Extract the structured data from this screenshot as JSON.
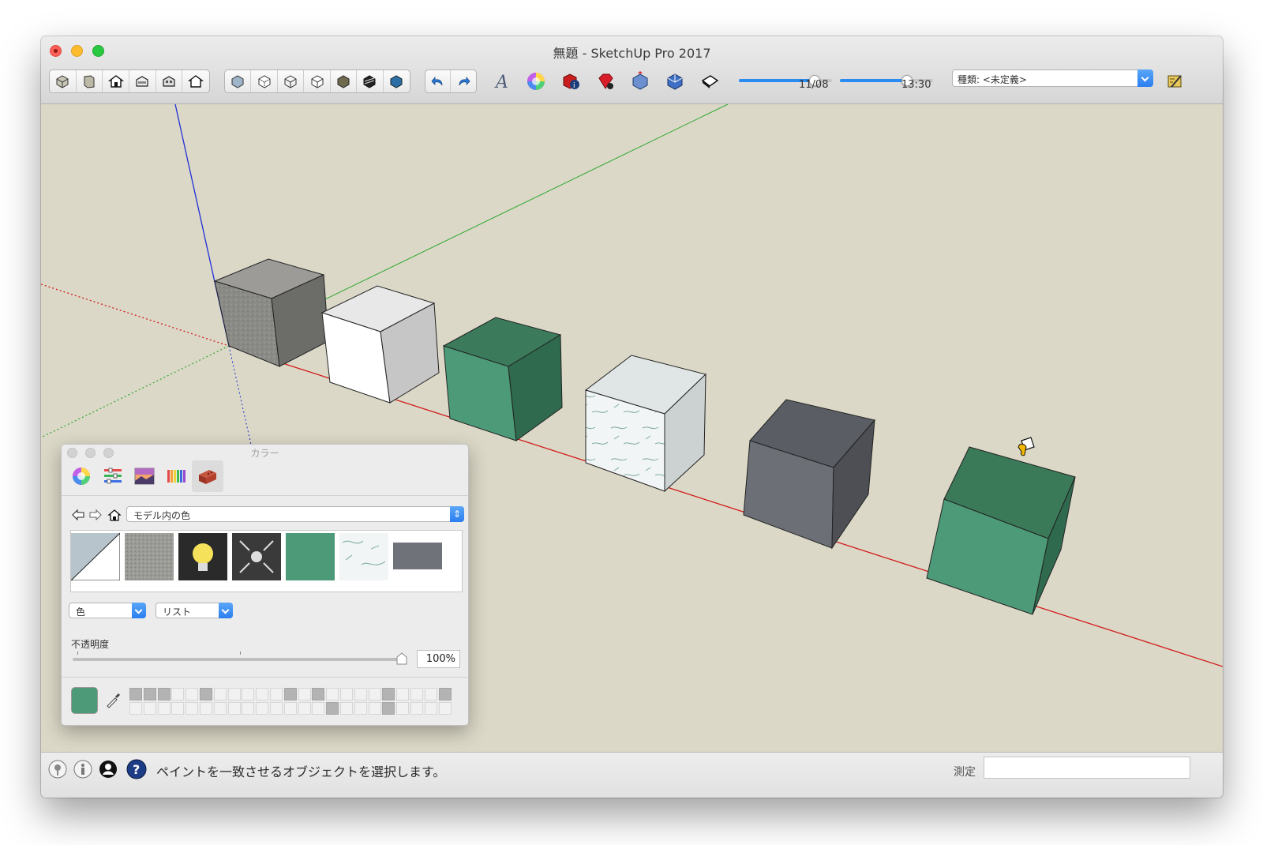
{
  "window": {
    "title": "無題 - SketchUp Pro 2017"
  },
  "toolbar": {
    "shadow_date": "11/08",
    "shadow_time": "13:30",
    "style_select_value": "種類: <未定義>",
    "colors": {
      "accent": "#2a8cf3"
    }
  },
  "color_panel": {
    "title": "カラー",
    "collection_select": "モデル内の色",
    "type_select": "色",
    "view_select": "リスト",
    "opacity_label": "不透明度",
    "opacity_value": "100%",
    "current_color": "#4c9a78"
  },
  "status": {
    "message": "ペイントを一致させるオブジェクトを選択します。",
    "measure_label": "測定",
    "measure_value": ""
  },
  "icons": {
    "toolbar_views": [
      "iso-view-icon",
      "top-view-icon",
      "front-view-icon",
      "right-view-icon",
      "back-view-icon",
      "left-view-icon"
    ],
    "toolbar_styles": [
      "xray-icon",
      "back-edges-icon",
      "wireframe-icon",
      "hidden-line-icon",
      "shaded-icon",
      "shaded-textures-icon",
      "monochrome-icon"
    ],
    "colors": {
      "green_material": "#4c9a78",
      "axis_red": "#d21c1c",
      "axis_green": "#2fa82f",
      "axis_blue": "#1f2fd8"
    }
  }
}
